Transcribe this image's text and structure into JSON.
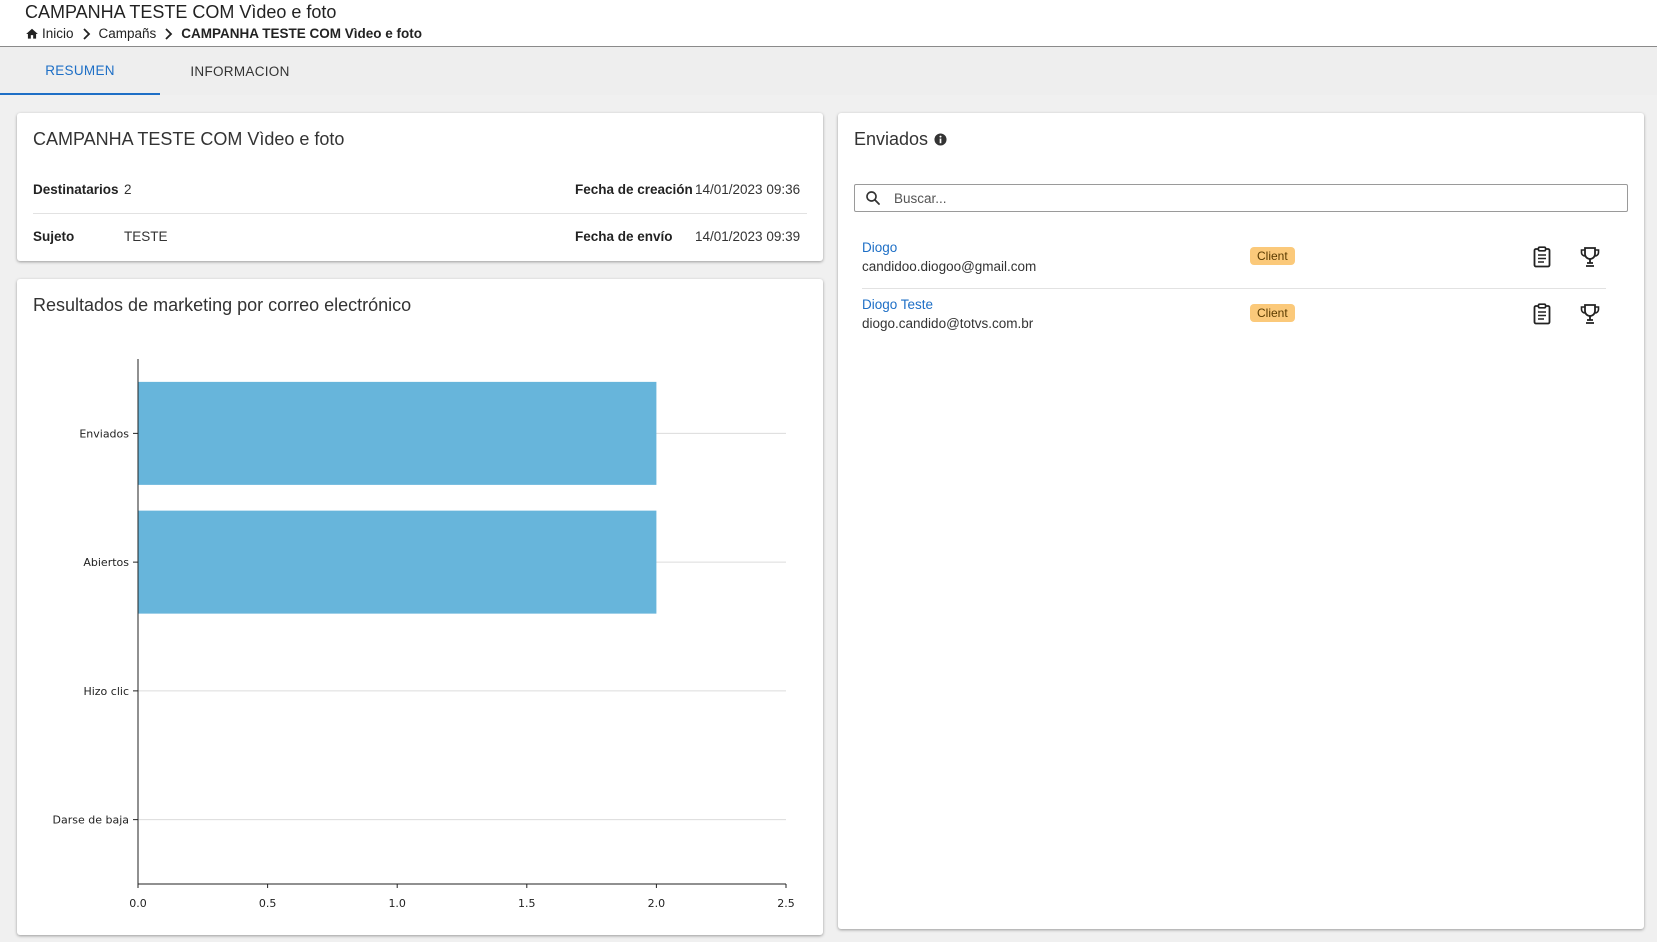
{
  "header": {
    "title": "CAMPANHA TESTE COM Vìdeo e foto",
    "breadcrumb": {
      "home": "Inicio",
      "campaigns": "Campañs",
      "current": "CAMPANHA TESTE COM Vìdeo e foto"
    }
  },
  "tabs": [
    {
      "label": "RESUMEN",
      "active": true
    },
    {
      "label": "INFORMACION",
      "active": false
    }
  ],
  "summary": {
    "title": "CAMPANHA TESTE COM Vìdeo e foto",
    "recipients_label": "Destinatarios",
    "recipients_value": "2",
    "created_label": "Fecha de creación",
    "created_value": "14/01/2023 09:36",
    "subject_label": "Sujeto",
    "subject_value": "TESTE",
    "sent_label": "Fecha de envío",
    "sent_value": "14/01/2023 09:39"
  },
  "results": {
    "title": "Resultados de marketing por correo electrónico"
  },
  "chart_data": {
    "type": "bar",
    "orientation": "horizontal",
    "categories": [
      "Enviados",
      "Abiertos",
      "Hizo clic",
      "Darse de baja"
    ],
    "values": [
      2,
      2,
      0,
      0
    ],
    "xlim": [
      0,
      2.5
    ],
    "xticks": [
      "0.0",
      "0.5",
      "1.0",
      "1.5",
      "2.0",
      "2.5"
    ],
    "grid": true,
    "bar_color": "#67b5db"
  },
  "sent_panel": {
    "title": "Enviados",
    "search_placeholder": "Buscar...",
    "recipients": [
      {
        "name": "Diogo",
        "email": "candidoo.diogoo@gmail.com",
        "badge": "Client"
      },
      {
        "name": "Diogo Teste",
        "email": "diogo.candido@totvs.com.br",
        "badge": "Client"
      }
    ]
  },
  "colors": {
    "accent": "#1e6fc6",
    "badge": "#fbc97a"
  }
}
